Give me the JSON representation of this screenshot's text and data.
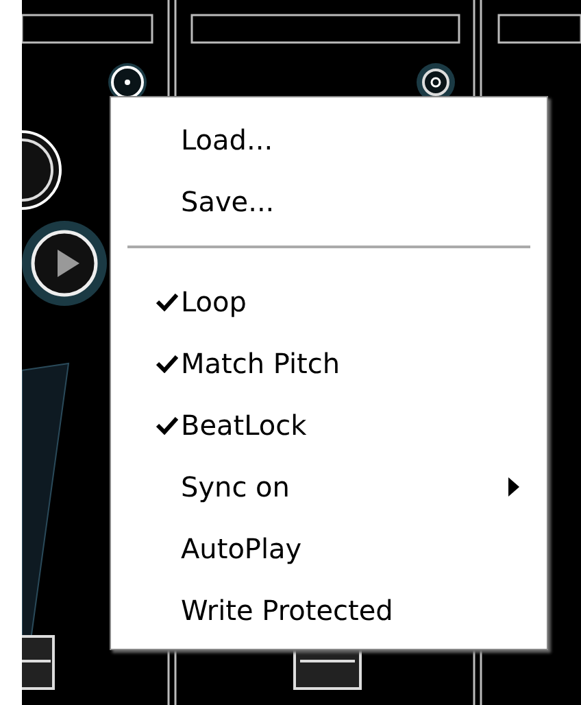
{
  "menu": {
    "items": [
      {
        "kind": "command",
        "label": "Load..."
      },
      {
        "kind": "command",
        "label": "Save..."
      },
      {
        "kind": "separator"
      },
      {
        "kind": "toggle",
        "label": "Loop",
        "checked": true
      },
      {
        "kind": "toggle",
        "label": "Match Pitch",
        "checked": true
      },
      {
        "kind": "toggle",
        "label": "BeatLock",
        "checked": true
      },
      {
        "kind": "submenu",
        "label": "Sync on"
      },
      {
        "kind": "toggle",
        "label": "AutoPlay",
        "checked": false
      },
      {
        "kind": "toggle",
        "label": "Write Protected",
        "checked": false
      }
    ]
  }
}
